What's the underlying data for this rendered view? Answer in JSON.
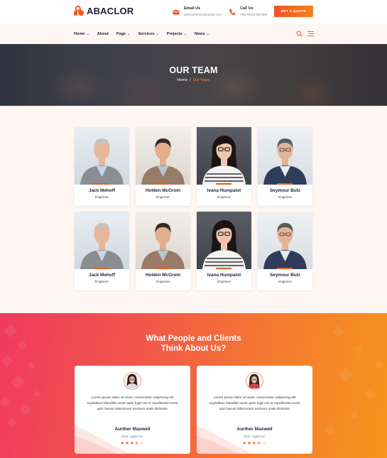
{
  "brand": {
    "name": "ABACLOR",
    "accent": "#f05a22"
  },
  "header": {
    "email_label": "Email Us",
    "email_value": "webexthemes@gmail.com",
    "call_label": "Call Us",
    "call_value": "+98-00234-567899",
    "quote_button": "GET A QUOTE"
  },
  "nav": {
    "items": [
      {
        "label": "Home",
        "dropdown": true
      },
      {
        "label": "About",
        "dropdown": false
      },
      {
        "label": "Page",
        "dropdown": true
      },
      {
        "label": "Services",
        "dropdown": true
      },
      {
        "label": "Projects",
        "dropdown": true
      },
      {
        "label": "News",
        "dropdown": true
      }
    ],
    "search_icon": "search-icon",
    "menu_icon": "hamburger-icon"
  },
  "hero": {
    "title": "OUR TEAM",
    "breadcrumb_home": "Home",
    "breadcrumb_sep": "/",
    "breadcrumb_current": "Our Team"
  },
  "team": [
    {
      "name": "Jack Mehoff",
      "role": "Engineer"
    },
    {
      "name": "Holden McGroin",
      "role": "Engineer"
    },
    {
      "name": "Ivana Humpalot",
      "role": "Engineer"
    },
    {
      "name": "Seymour Butz",
      "role": "Engineer"
    },
    {
      "name": "Jack Mehoff",
      "role": "Engineer"
    },
    {
      "name": "Holden McGroin",
      "role": "Engineer"
    },
    {
      "name": "Ivana Humpalot",
      "role": "Engineer"
    },
    {
      "name": "Seymour Butz",
      "role": "Engineer"
    }
  ],
  "testimonials": {
    "title_line1": "What People and Clients",
    "title_line2": "Think About Us?",
    "items": [
      {
        "quote": "Lorem ipsum dolor sit amet, consectetur adipiscing elit ouptatibus blanditiis amet optio fugit nisi et repellendus tuste quis harum laboriosam nostrum unde distinctio",
        "name": "Aurther Maxwell",
        "position": "CEO, Apple Inc.",
        "stars": "★★★⯪☆"
      },
      {
        "quote": "Lorem ipsum dolor sit amet, consectetur adipiscing elit ouptatibus blanditiis amet optio fugit nisi et repellendus tuste quis harum laboriosam nostrum unde distinctio",
        "name": "Aurther Maxwell",
        "position": "CEO, Apple Inc.",
        "stars": "★★★⯪☆"
      }
    ]
  }
}
